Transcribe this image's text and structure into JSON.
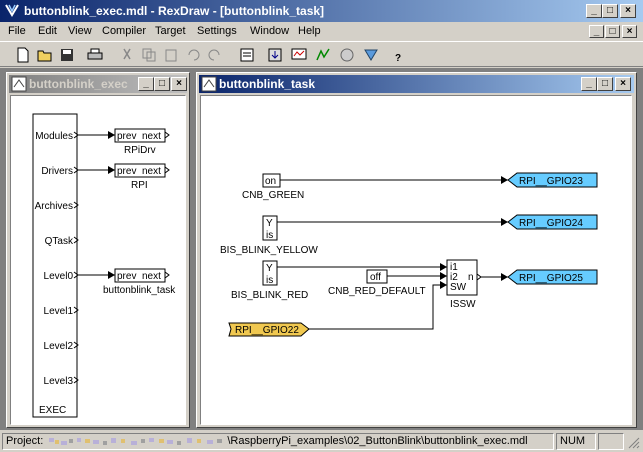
{
  "window": {
    "title": "buttonblink_exec.mdl - RexDraw - [buttonblink_task]"
  },
  "menu": [
    "File",
    "Edit",
    "View",
    "Compiler",
    "Target",
    "Settings",
    "Window",
    "Help"
  ],
  "toolbar": [
    "new-icon",
    "open-icon",
    "save-icon",
    "print-icon",
    "cut-icon",
    "copy-icon",
    "paste-icon",
    "undo-icon",
    "redo-icon",
    "compile-icon",
    "download-icon",
    "watch-icon",
    "diagnostics-icon",
    "simulate-icon",
    "help-icon"
  ],
  "exec_window": {
    "title": "buttonblink_exec",
    "block_name": "EXEC",
    "ports": [
      "Modules",
      "Drivers",
      "Archives",
      "QTask",
      "Level0",
      "Level1",
      "Level2",
      "Level3"
    ],
    "links": [
      {
        "prev": "prev",
        "next": "next",
        "name": "RPiDrv"
      },
      {
        "prev": "prev",
        "next": "next",
        "name": "RPI"
      },
      {
        "prev": "prev",
        "next": "next",
        "name": "buttonblink_task"
      }
    ]
  },
  "task_window": {
    "title": "buttonblink_task",
    "cnb_green": {
      "value": "on",
      "name": "CNB_GREEN"
    },
    "bis_yellow": {
      "port_y": "Y",
      "port_is": "is",
      "name": "BIS_BLINK_YELLOW"
    },
    "bis_red": {
      "port_y": "Y",
      "port_is": "is",
      "name": "BIS_BLINK_RED"
    },
    "cnb_red_default": {
      "value": "off",
      "name": "CNB_RED_DEFAULT"
    },
    "issw": {
      "in1": "i1",
      "in2": "i2",
      "sw": "SW",
      "out": "n",
      "name": "ISSW"
    },
    "goto": [
      "RPI__GPIO23",
      "RPI__GPIO24",
      "RPI__GPIO25"
    ],
    "from": "RPI__GPIO22"
  },
  "status": {
    "project_label": "Project:",
    "path": "\\RaspberryPi_examples\\02_ButtonBlink\\buttonblink_exec.mdl",
    "num": "NUM"
  },
  "colors": {
    "goto": "#66ccff",
    "from": "#f0c850"
  }
}
